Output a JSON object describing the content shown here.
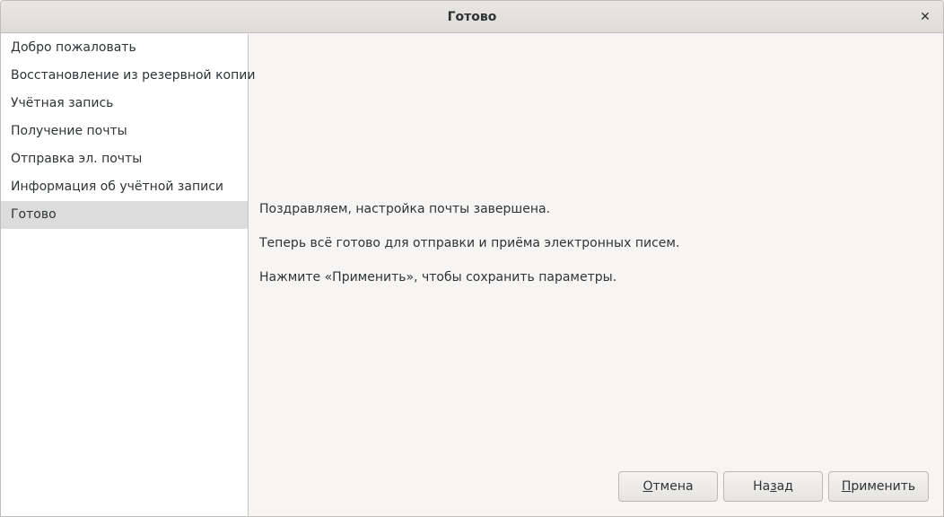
{
  "window": {
    "title": "Готово"
  },
  "sidebar": {
    "items": [
      {
        "label": "Добро пожаловать"
      },
      {
        "label": "Восстановление из резервной копии"
      },
      {
        "label": "Учётная запись"
      },
      {
        "label": "Получение почты"
      },
      {
        "label": "Отправка эл. почты"
      },
      {
        "label": "Информация об учётной записи"
      },
      {
        "label": "Готово",
        "selected": true
      }
    ]
  },
  "content": {
    "line1": "Поздравляем, настройка почты завершена.",
    "line2": "Теперь всё готово для отправки и приёма электронных писем.",
    "line3": "Нажмите «Применить», чтобы сохранить параметры."
  },
  "buttons": {
    "cancel": {
      "mnemonic": "О",
      "rest": "тмена"
    },
    "back": {
      "pre": "На",
      "mnemonic": "з",
      "rest": "ад"
    },
    "apply": {
      "mnemonic": "П",
      "rest": "рименить"
    }
  }
}
